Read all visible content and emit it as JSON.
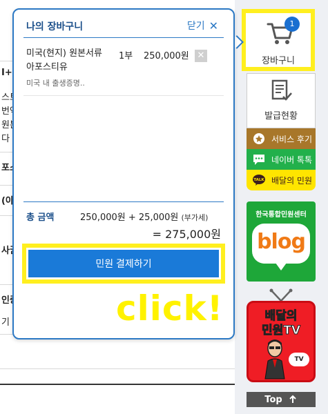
{
  "background": {
    "fragments": [
      "I+(",
      "스트",
      "번역",
      "원본",
      "다",
      "포스",
      "(아",
      "사권",
      "인증",
      "기"
    ]
  },
  "sidebar": {
    "cart": {
      "label": "장바구니",
      "badge": "1",
      "icon": "cart-icon"
    },
    "issue": {
      "label": "발급현황",
      "icon": "document-check-icon"
    },
    "review": {
      "label": "서비스 후기",
      "icon": "badge-icon",
      "color": "#a8772a"
    },
    "naver_talk": {
      "label": "네이버 톡톡",
      "icon": "chat-icon",
      "color": "#22b04b"
    },
    "kakao": {
      "label": "배달의 민원",
      "badge": "TALK",
      "icon": "kakao-talk-icon",
      "color": "#ffe500"
    },
    "blog": {
      "title": "한국통합민원센터",
      "word": "blog",
      "color": "#1ea739"
    },
    "tv": {
      "line1": "배달의",
      "line2": "민원TV",
      "bubble": "TV",
      "color": "#ef1d25"
    },
    "top_button": {
      "label": "Top",
      "icon": "arrow-up-icon"
    }
  },
  "cart_panel": {
    "title": "나의 장바구니",
    "close_label": "닫기",
    "items": [
      {
        "name": "미국(현지) 원본서류 아포스티유",
        "qty": "1부",
        "price": "250,000원",
        "desc": "미국 내 출생증명.."
      }
    ],
    "total_label": "총 금액",
    "subtotal": "250,000원",
    "plus": "+",
    "fee": "25,000원",
    "vat_note": "(부가세)",
    "equals": "=",
    "total": "275,000원",
    "pay_button": "민원 결제하기",
    "accent": "#2b78c4"
  },
  "overlay": {
    "click_text": "click!",
    "highlight_color": "#ffef1f"
  }
}
